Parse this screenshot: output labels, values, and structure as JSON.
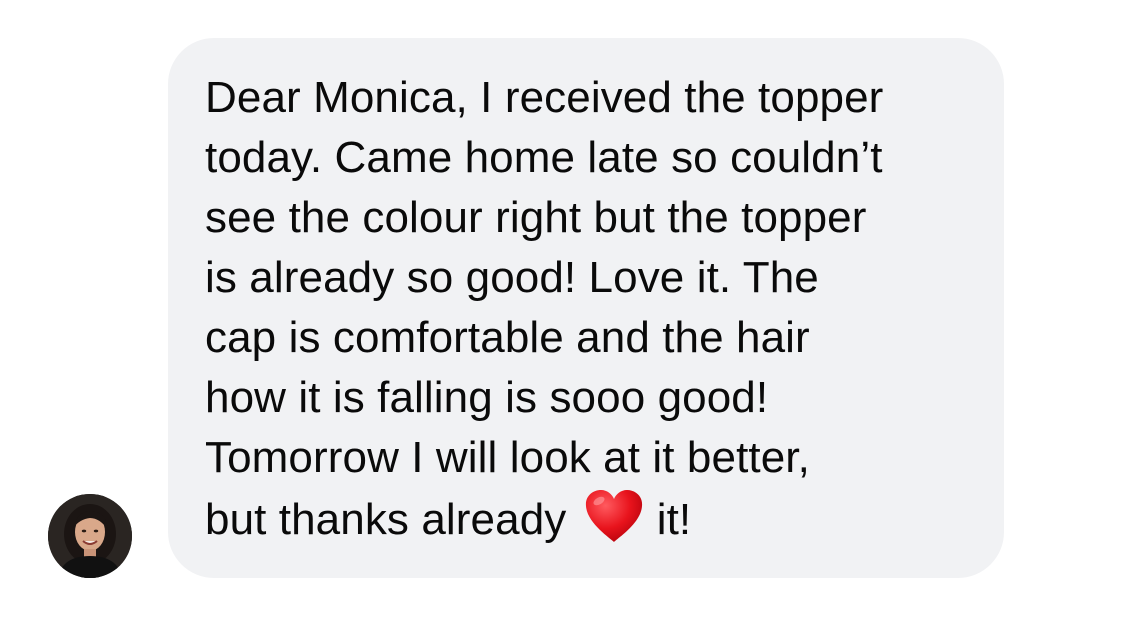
{
  "conversation": {
    "sender_avatar_icon": "avatar-photo-woman",
    "bubble_color": "#f1f2f4",
    "heart_color": "#e8131c",
    "message_lines": [
      "Dear Monica, I received the topper",
      "today. Came home late so couldn’t",
      "see the colour right but the topper",
      "is already so good! Love it. The",
      "cap is comfortable and the hair",
      "how it is falling is sooo good!",
      "Tomorrow I will look at it better,"
    ],
    "last_line_before_emoji": "but thanks already",
    "emoji_icon": "red-heart-emoji",
    "last_line_after_emoji": "it!"
  }
}
